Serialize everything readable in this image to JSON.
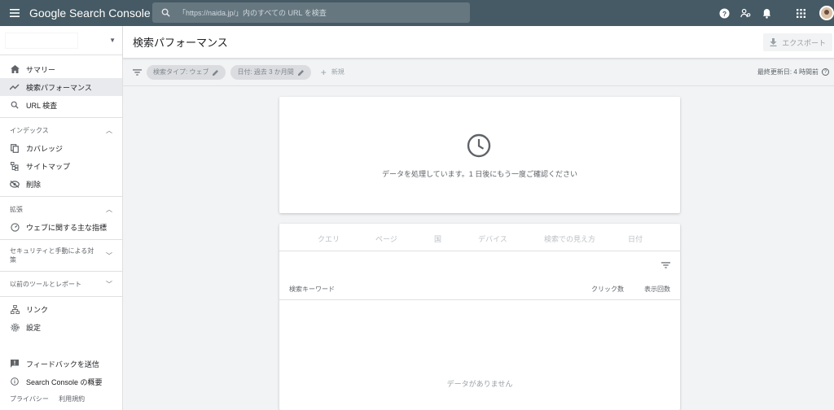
{
  "topbar": {
    "brand": "Google Search Console",
    "search_placeholder": "「https://naida.jp/」内のすべての URL を検査"
  },
  "sidebar": {
    "items": [
      {
        "label": "サマリー"
      },
      {
        "label": "検索パフォーマンス"
      },
      {
        "label": "URL 検査"
      }
    ],
    "sections": {
      "index": {
        "title": "インデックス",
        "items": [
          "カバレッジ",
          "サイトマップ",
          "削除"
        ]
      },
      "enhance": {
        "title": "拡張",
        "items": [
          "ウェブに関する主な指標"
        ]
      },
      "security": {
        "title": "セキュリティと手動による対策"
      },
      "legacy": {
        "title": "以前のツールとレポート"
      }
    },
    "bottom_items": [
      "リンク",
      "設定"
    ],
    "feedback": "フィードバックを送信",
    "about": "Search Console の概要",
    "footer": [
      "プライバシー",
      "利用規約"
    ]
  },
  "header": {
    "title": "検索パフォーマンス",
    "export": "エクスポート"
  },
  "filters": {
    "chips": [
      "検索タイプ: ウェブ",
      "日付: 過去 3 か月間"
    ],
    "new_label": "新規",
    "updated": "最終更新日: 4 時間前"
  },
  "status_card": {
    "message": "データを処理しています。1 日後にもう一度ご確認ください"
  },
  "table_card": {
    "tabs": [
      "クエリ",
      "ページ",
      "国",
      "デバイス",
      "検索での見え方",
      "日付"
    ],
    "columns": [
      "検索キーワード",
      "クリック数",
      "表示回数"
    ],
    "empty": "データがありません"
  }
}
